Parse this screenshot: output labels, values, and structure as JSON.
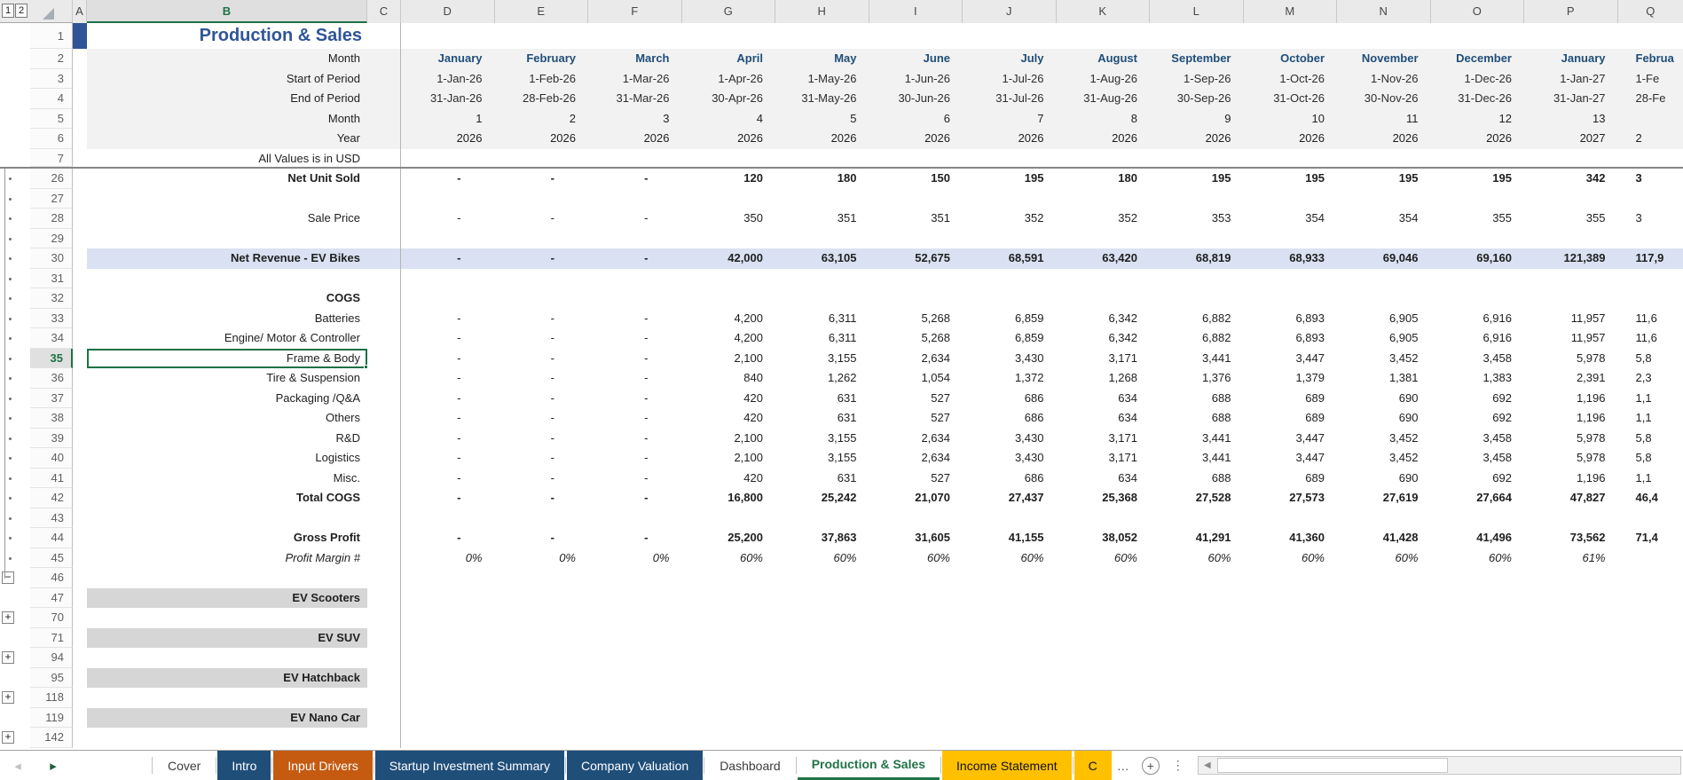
{
  "sheet_title": "Production & Sales",
  "outline": {
    "level_buttons": [
      "1",
      "2"
    ],
    "collapse_button_rows": [
      "46"
    ],
    "expand_button_rows": [
      "70",
      "94",
      "118",
      "142"
    ]
  },
  "columns": [
    "A",
    "B",
    "C",
    "D",
    "E",
    "F",
    "G",
    "H",
    "I",
    "J",
    "K",
    "L",
    "M",
    "N",
    "O",
    "P",
    "Q"
  ],
  "selection": {
    "cell": "B35",
    "value": "Frame & Body",
    "column": "B",
    "row": "35"
  },
  "colors": {
    "title_blue": "#2F5597",
    "month_blue": "#1F4E79",
    "band_gray": "#F2F2F2",
    "band_blue": "#D9E1F2",
    "bar_gray": "#D6D6D6",
    "active_green": "#1E7145",
    "tab_blue": "#1F4E79",
    "tab_orange": "#C55A11",
    "tab_gold": "#FFC000"
  },
  "rows": [
    {
      "n": "1",
      "type": "title",
      "label": "Production & Sales"
    },
    {
      "n": "2",
      "type": "head",
      "label": "Month",
      "months": true,
      "v": [
        "January",
        "February",
        "March",
        "April",
        "May",
        "June",
        "July",
        "August",
        "September",
        "October",
        "November",
        "December",
        "January",
        "Februa"
      ]
    },
    {
      "n": "3",
      "type": "head",
      "label": "Start of Period",
      "date": true,
      "v": [
        "1-Jan-26",
        "1-Feb-26",
        "1-Mar-26",
        "1-Apr-26",
        "1-May-26",
        "1-Jun-26",
        "1-Jul-26",
        "1-Aug-26",
        "1-Sep-26",
        "1-Oct-26",
        "1-Nov-26",
        "1-Dec-26",
        "1-Jan-27",
        "1-Fe"
      ]
    },
    {
      "n": "4",
      "type": "head",
      "label": "End of Period",
      "date": true,
      "v": [
        "31-Jan-26",
        "28-Feb-26",
        "31-Mar-26",
        "30-Apr-26",
        "31-May-26",
        "30-Jun-26",
        "31-Jul-26",
        "31-Aug-26",
        "30-Sep-26",
        "31-Oct-26",
        "30-Nov-26",
        "31-Dec-26",
        "31-Jan-27",
        "28-Fe"
      ]
    },
    {
      "n": "5",
      "type": "head",
      "label": "Month",
      "v": [
        "1",
        "2",
        "3",
        "4",
        "5",
        "6",
        "7",
        "8",
        "9",
        "10",
        "11",
        "12",
        "13",
        ""
      ]
    },
    {
      "n": "6",
      "type": "head",
      "label": "Year",
      "v": [
        "2026",
        "2026",
        "2026",
        "2026",
        "2026",
        "2026",
        "2026",
        "2026",
        "2026",
        "2026",
        "2026",
        "2026",
        "2027",
        "2"
      ]
    },
    {
      "n": "7",
      "type": "note",
      "label": "All Values is in USD"
    },
    {
      "n": "26",
      "mark": "dot",
      "label": "Net Unit Sold",
      "bold": true,
      "vb": true,
      "v": [
        "-",
        "-",
        "-",
        "120",
        "180",
        "150",
        "195",
        "180",
        "195",
        "195",
        "195",
        "195",
        "342",
        "3"
      ]
    },
    {
      "n": "27",
      "mark": "dot"
    },
    {
      "n": "28",
      "mark": "dot",
      "label": "Sale Price",
      "v": [
        "-",
        "-",
        "-",
        "350",
        "351",
        "351",
        "352",
        "352",
        "353",
        "354",
        "354",
        "355",
        "355",
        "3"
      ]
    },
    {
      "n": "29",
      "mark": "dot"
    },
    {
      "n": "30",
      "mark": "dot",
      "label": "Net Revenue - EV Bikes",
      "bold": true,
      "vb": true,
      "band": "blue",
      "v": [
        "-",
        "-",
        "-",
        "42,000",
        "63,105",
        "52,675",
        "68,591",
        "63,420",
        "68,819",
        "68,933",
        "69,046",
        "69,160",
        "121,389",
        "117,9"
      ]
    },
    {
      "n": "31",
      "mark": "dot"
    },
    {
      "n": "32",
      "mark": "dot",
      "label": "COGS",
      "bold": true
    },
    {
      "n": "33",
      "mark": "dot",
      "label": "Batteries",
      "v": [
        "-",
        "-",
        "-",
        "4,200",
        "6,311",
        "5,268",
        "6,859",
        "6,342",
        "6,882",
        "6,893",
        "6,905",
        "6,916",
        "11,957",
        "11,6"
      ]
    },
    {
      "n": "34",
      "mark": "dot",
      "label": "Engine/ Motor & Controller",
      "v": [
        "-",
        "-",
        "-",
        "4,200",
        "6,311",
        "5,268",
        "6,859",
        "6,342",
        "6,882",
        "6,893",
        "6,905",
        "6,916",
        "11,957",
        "11,6"
      ]
    },
    {
      "n": "35",
      "mark": "dot",
      "label": "Frame & Body",
      "selected": true,
      "v": [
        "-",
        "-",
        "-",
        "2,100",
        "3,155",
        "2,634",
        "3,430",
        "3,171",
        "3,441",
        "3,447",
        "3,452",
        "3,458",
        "5,978",
        "5,8"
      ]
    },
    {
      "n": "36",
      "mark": "dot",
      "label": "Tire & Suspension",
      "v": [
        "-",
        "-",
        "-",
        "840",
        "1,262",
        "1,054",
        "1,372",
        "1,268",
        "1,376",
        "1,379",
        "1,381",
        "1,383",
        "2,391",
        "2,3"
      ]
    },
    {
      "n": "37",
      "mark": "dot",
      "label": "Packaging /Q&A",
      "v": [
        "-",
        "-",
        "-",
        "420",
        "631",
        "527",
        "686",
        "634",
        "688",
        "689",
        "690",
        "692",
        "1,196",
        "1,1"
      ]
    },
    {
      "n": "38",
      "mark": "dot",
      "label": "Others",
      "v": [
        "-",
        "-",
        "-",
        "420",
        "631",
        "527",
        "686",
        "634",
        "688",
        "689",
        "690",
        "692",
        "1,196",
        "1,1"
      ]
    },
    {
      "n": "39",
      "mark": "dot",
      "label": "R&D",
      "v": [
        "-",
        "-",
        "-",
        "2,100",
        "3,155",
        "2,634",
        "3,430",
        "3,171",
        "3,441",
        "3,447",
        "3,452",
        "3,458",
        "5,978",
        "5,8"
      ]
    },
    {
      "n": "40",
      "mark": "dot",
      "label": "Logistics",
      "v": [
        "-",
        "-",
        "-",
        "2,100",
        "3,155",
        "2,634",
        "3,430",
        "3,171",
        "3,441",
        "3,447",
        "3,452",
        "3,458",
        "5,978",
        "5,8"
      ]
    },
    {
      "n": "41",
      "mark": "dot",
      "label": "Misc.",
      "v": [
        "-",
        "-",
        "-",
        "420",
        "631",
        "527",
        "686",
        "634",
        "688",
        "689",
        "690",
        "692",
        "1,196",
        "1,1"
      ]
    },
    {
      "n": "42",
      "mark": "dot",
      "label": "Total COGS",
      "bold": true,
      "vb": true,
      "v": [
        "-",
        "-",
        "-",
        "16,800",
        "25,242",
        "21,070",
        "27,437",
        "25,368",
        "27,528",
        "27,573",
        "27,619",
        "27,664",
        "47,827",
        "46,4"
      ]
    },
    {
      "n": "43",
      "mark": "dot"
    },
    {
      "n": "44",
      "mark": "dot",
      "label": "Gross Profit",
      "bold": true,
      "vb": true,
      "v": [
        "-",
        "-",
        "-",
        "25,200",
        "37,863",
        "31,605",
        "41,155",
        "38,052",
        "41,291",
        "41,360",
        "41,428",
        "41,496",
        "73,562",
        "71,4"
      ]
    },
    {
      "n": "45",
      "mark": "dot",
      "label": "Profit Margin #",
      "italic": true,
      "vi": true,
      "v": [
        "0%",
        "0%",
        "0%",
        "60%",
        "60%",
        "60%",
        "60%",
        "60%",
        "60%",
        "60%",
        "60%",
        "60%",
        "61%",
        ""
      ]
    },
    {
      "n": "46",
      "mark": "minus"
    },
    {
      "n": "47",
      "label": "EV Scooters",
      "bold": true,
      "band": "bar"
    },
    {
      "n": "70",
      "mark": "plus"
    },
    {
      "n": "71",
      "label": "EV SUV",
      "bold": true,
      "band": "bar"
    },
    {
      "n": "94",
      "mark": "plus"
    },
    {
      "n": "95",
      "label": "EV Hatchback",
      "bold": true,
      "band": "bar"
    },
    {
      "n": "118",
      "mark": "plus"
    },
    {
      "n": "119",
      "label": "EV Nano Car",
      "bold": true,
      "band": "bar"
    },
    {
      "n": "142",
      "mark": "plus"
    }
  ],
  "tabbar": {
    "icons": {
      "nav_prev": "◂",
      "nav_next": "▸",
      "ellipsis": "…",
      "add_sheet": "+",
      "more": "⋮",
      "scroll_left": "◀"
    },
    "tabs": [
      {
        "label": "Cover",
        "style": "light"
      },
      {
        "label": "Intro",
        "style": "blue"
      },
      {
        "label": "Input Drivers",
        "style": "orange"
      },
      {
        "label": "Startup Investment Summary",
        "style": "blue"
      },
      {
        "label": "Company Valuation",
        "style": "blue"
      },
      {
        "label": "Dashboard",
        "style": "light"
      },
      {
        "label": "Production & Sales",
        "style": "active"
      },
      {
        "label": "Income Statement",
        "style": "gold"
      },
      {
        "label": "C",
        "style": "gold"
      }
    ]
  }
}
